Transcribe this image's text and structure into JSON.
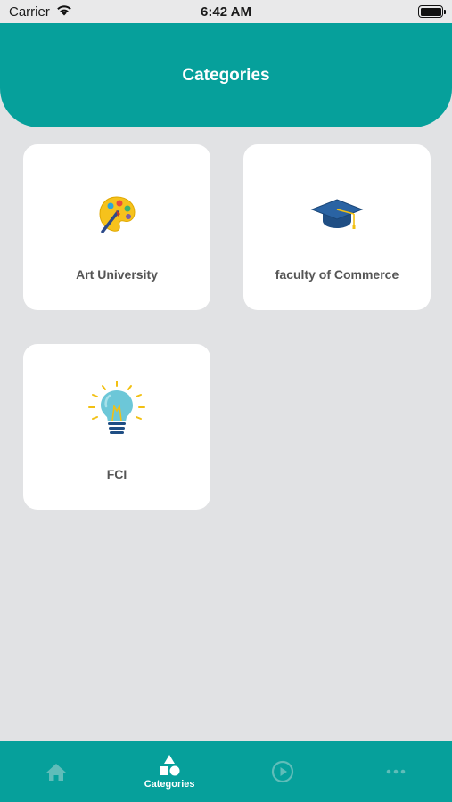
{
  "status_bar": {
    "carrier": "Carrier",
    "time": "6:42 AM"
  },
  "header": {
    "title": "Categories"
  },
  "categories": [
    {
      "label": "Art University",
      "icon": "palette-icon"
    },
    {
      "label": "faculty of Commerce",
      "icon": "graduation-cap-icon"
    },
    {
      "label": "FCI",
      "icon": "lightbulb-icon"
    }
  ],
  "tab_bar": {
    "tabs": [
      {
        "icon": "home-icon",
        "label": "",
        "active": false
      },
      {
        "icon": "shapes-icon",
        "label": "Categories",
        "active": true
      },
      {
        "icon": "play-circle-icon",
        "label": "",
        "active": false
      },
      {
        "icon": "more-icon",
        "label": "",
        "active": false
      }
    ]
  },
  "colors": {
    "accent": "#06a09b",
    "background": "#e1e2e4",
    "card": "#ffffff",
    "label_text": "#555555",
    "inactive_tab_icon": "#5fbdb9"
  }
}
